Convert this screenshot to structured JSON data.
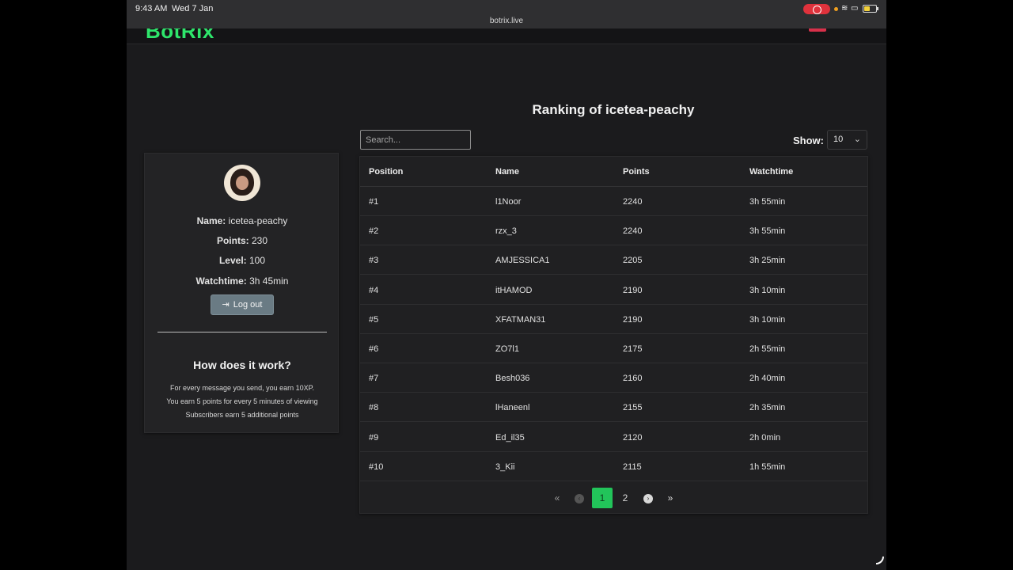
{
  "status_bar": {
    "time": "9:43 AM",
    "date": "Wed 7 Jan"
  },
  "browser": {
    "url": "botrix.live"
  },
  "site": {
    "logo": "BotRix"
  },
  "page": {
    "title": "Ranking of icetea-peachy"
  },
  "profile": {
    "name_label": "Name:",
    "name": "icetea-peachy",
    "points_label": "Points:",
    "points": "230",
    "level_label": "Level:",
    "level": "100",
    "watchtime_label": "Watchtime:",
    "watchtime": "3h 45min",
    "logout_label": "Log out",
    "how_title": "How does it work?",
    "how_lines": [
      "For every message you send, you earn 10XP.",
      "You earn 5 points for every 5 minutes of viewing",
      "Subscribers earn 5 additional points"
    ]
  },
  "controls": {
    "search_placeholder": "Search...",
    "show_label": "Show:",
    "show_value": "10"
  },
  "table": {
    "headers": [
      "Position",
      "Name",
      "Points",
      "Watchtime"
    ],
    "rows": [
      [
        "#1",
        "l1Noor",
        "2240",
        "3h 55min"
      ],
      [
        "#2",
        "rzx_3",
        "2240",
        "3h 55min"
      ],
      [
        "#3",
        "AMJESSICA1",
        "2205",
        "3h 25min"
      ],
      [
        "#4",
        "itHAMOD",
        "2190",
        "3h 10min"
      ],
      [
        "#5",
        "XFATMAN31",
        "2190",
        "3h 10min"
      ],
      [
        "#6",
        "ZO7l1",
        "2175",
        "2h 55min"
      ],
      [
        "#7",
        "Besh036",
        "2160",
        "2h 40min"
      ],
      [
        "#8",
        "lHaneenl",
        "2155",
        "2h 35min"
      ],
      [
        "#9",
        "Ed_il35",
        "2120",
        "2h 0min"
      ],
      [
        "#10",
        "3_Kii",
        "2115",
        "1h 55min"
      ]
    ]
  },
  "pagination": {
    "first": "«",
    "prev": "‹",
    "pages": [
      "1",
      "2"
    ],
    "current": "1",
    "next": "›",
    "last": "»"
  },
  "colors": {
    "accent": "#22c45a",
    "background": "#1b1b1d",
    "logout": "#6a7b84"
  }
}
